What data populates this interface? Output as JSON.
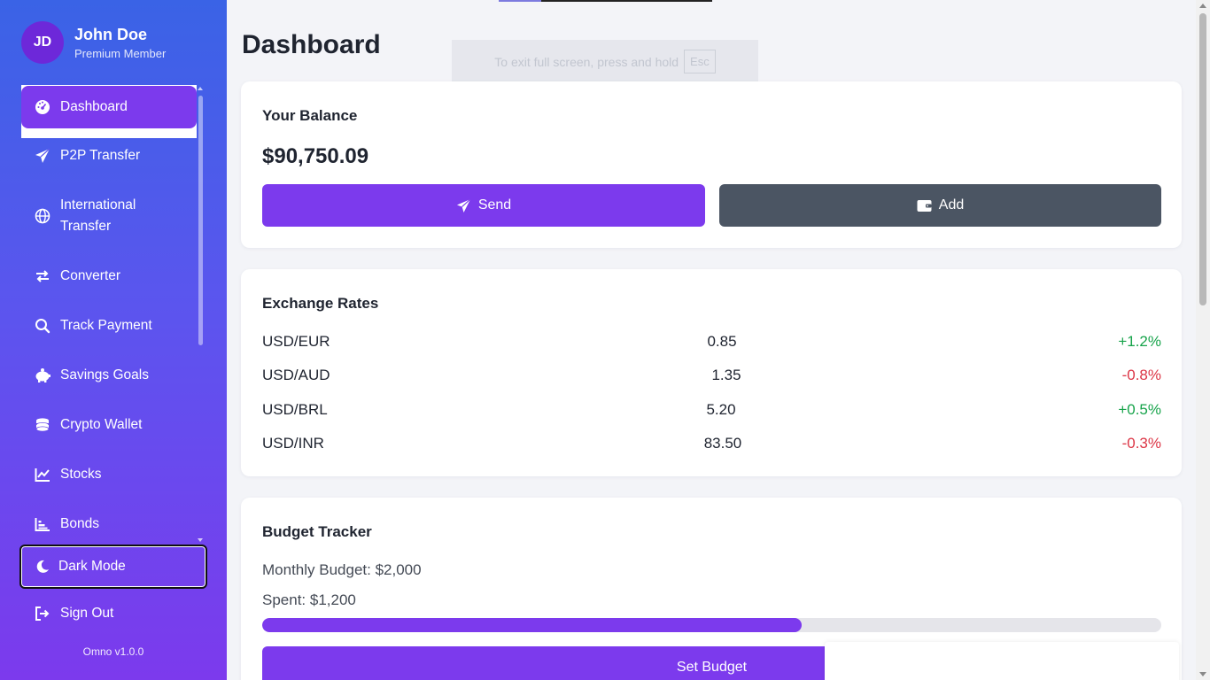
{
  "user": {
    "initials": "JD",
    "name": "John Doe",
    "role": "Premium Member"
  },
  "sidebar": {
    "items": [
      {
        "label": "Dashboard",
        "icon": "dashboard-icon"
      },
      {
        "label": "P2P Transfer",
        "icon": "paper-plane-icon"
      },
      {
        "label": "International",
        "label2": "Transfer",
        "icon": "globe-icon"
      },
      {
        "label": "Converter",
        "icon": "exchange-arrows-icon"
      },
      {
        "label": "Track Payment",
        "icon": "search-icon"
      },
      {
        "label": "Savings Goals",
        "icon": "piggy-bank-icon"
      },
      {
        "label": "Crypto Wallet",
        "icon": "coins-icon"
      },
      {
        "label": "Stocks",
        "icon": "line-chart-icon"
      },
      {
        "label": "Bonds",
        "icon": "bar-chart-icon"
      }
    ],
    "dark_mode_label": "Dark Mode",
    "sign_out_label": "Sign Out",
    "version": "Omno v1.0.0"
  },
  "page": {
    "title": "Dashboard",
    "fullscreen_toast": "To exit full screen, press and hold",
    "fullscreen_key": "Esc"
  },
  "balance": {
    "title": "Your Balance",
    "amount": "$90,750.09",
    "send_label": "Send",
    "add_label": "Add"
  },
  "rates": {
    "title": "Exchange Rates",
    "rows": [
      {
        "pair": "USD/EUR",
        "value": "0.85",
        "change": "+1.2%"
      },
      {
        "pair": "USD/AUD",
        "value": "1.35",
        "change": "-0.8%"
      },
      {
        "pair": "USD/BRL",
        "value": "5.20",
        "change": "+0.5%"
      },
      {
        "pair": "USD/INR",
        "value": "83.50",
        "change": "-0.3%"
      }
    ]
  },
  "budget": {
    "title": "Budget Tracker",
    "monthly": "Monthly Budget: $2,000",
    "spent": "Spent: $1,200",
    "progress_fraction": 0.6,
    "set_budget_label": "Set Budget"
  },
  "colors": {
    "accent": "#7c3aed",
    "positive": "#16a34a",
    "negative": "#dc3545",
    "secondary_button": "#4b5563"
  }
}
